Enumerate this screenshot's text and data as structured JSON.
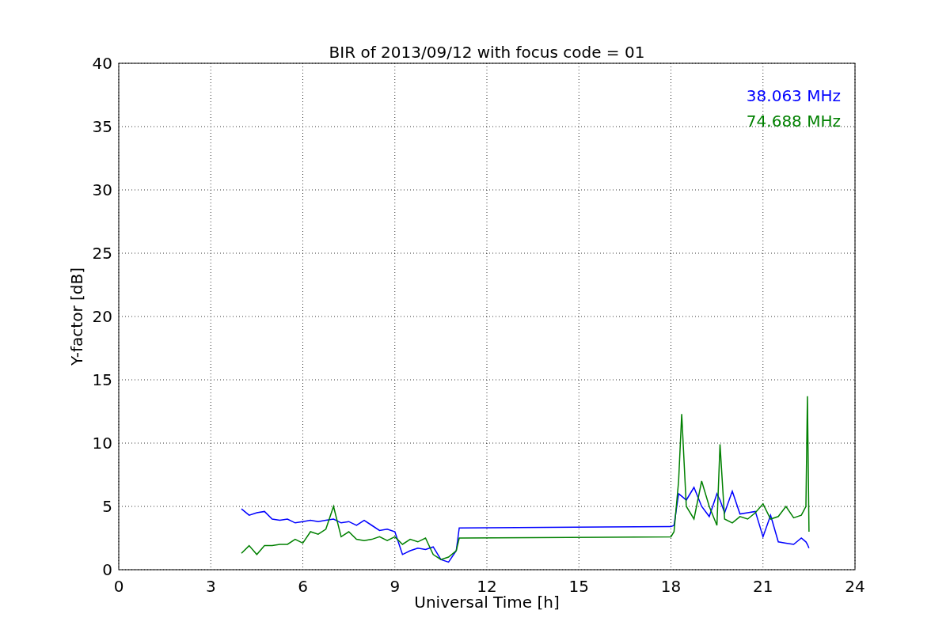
{
  "figure": {
    "chart_data": {
      "type": "line",
      "title": "BIR of 2013/09/12 with focus code = 01",
      "xlabel": "Universal Time [h]",
      "ylabel": "Y-factor [dB]",
      "x": [
        4,
        4.25,
        4.5,
        4.75,
        5,
        5.25,
        5.5,
        5.75,
        6,
        6.25,
        6.5,
        6.75,
        7,
        7.25,
        7.5,
        7.75,
        8,
        8.25,
        8.5,
        8.75,
        9,
        9.25,
        9.5,
        9.75,
        10,
        10.25,
        10.5,
        10.75,
        11,
        11.1,
        18,
        18.1,
        18.25,
        18.35,
        18.5,
        18.75,
        19,
        19.25,
        19.5,
        19.6,
        19.75,
        20,
        20.25,
        20.5,
        20.75,
        21,
        21.25,
        21.5,
        21.75,
        22,
        22.25,
        22.4,
        22.45,
        22.5
      ],
      "series": [
        {
          "name": "38.063 MHz",
          "color": "#0000ff",
          "values": [
            4.8,
            4.3,
            4.5,
            4.6,
            4.0,
            3.9,
            4.0,
            3.7,
            3.8,
            3.9,
            3.8,
            3.9,
            4.0,
            3.7,
            3.8,
            3.5,
            3.9,
            3.5,
            3.1,
            3.2,
            3.0,
            1.2,
            1.5,
            1.7,
            1.6,
            1.8,
            0.8,
            0.6,
            1.5,
            3.3,
            3.4,
            3.5,
            6.0,
            5.8,
            5.5,
            6.5,
            5.0,
            4.2,
            6.0,
            5.5,
            4.5,
            6.2,
            4.4,
            4.5,
            4.6,
            2.6,
            4.3,
            2.2,
            2.1,
            2.0,
            2.5,
            2.2,
            2.0,
            1.7
          ]
        },
        {
          "name": "74.688 MHz",
          "color": "#008000",
          "values": [
            1.3,
            1.9,
            1.2,
            1.9,
            1.9,
            2.0,
            2.0,
            2.4,
            2.1,
            3.0,
            2.8,
            3.2,
            5.0,
            2.6,
            3.0,
            2.4,
            2.3,
            2.4,
            2.6,
            2.3,
            2.6,
            2.0,
            2.4,
            2.2,
            2.5,
            1.2,
            0.8,
            1.0,
            1.5,
            2.5,
            2.6,
            3.0,
            7.0,
            12.3,
            5.0,
            4.0,
            7.0,
            5.0,
            3.5,
            9.9,
            4.0,
            3.7,
            4.2,
            4.0,
            4.5,
            5.2,
            4.0,
            4.2,
            5.0,
            4.1,
            4.3,
            5.0,
            13.7,
            3.0
          ]
        }
      ],
      "xlim": [
        0,
        24
      ],
      "ylim": [
        0,
        40
      ],
      "xticks": [
        0,
        3,
        6,
        9,
        12,
        15,
        18,
        21,
        24
      ],
      "yticks": [
        0,
        5,
        10,
        15,
        20,
        25,
        30,
        35,
        40
      ],
      "grid": true
    }
  }
}
